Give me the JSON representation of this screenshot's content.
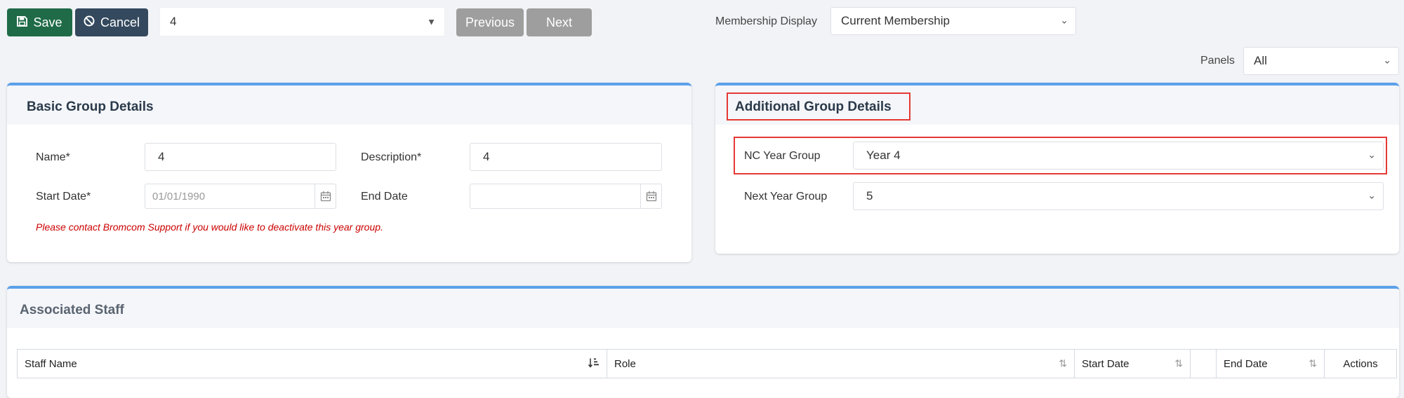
{
  "toolbar": {
    "save_label": "Save",
    "cancel_label": "Cancel",
    "group_select_value": "4",
    "previous_label": "Previous",
    "next_label": "Next",
    "membership_display_label": "Membership Display",
    "membership_display_value": "Current Membership",
    "panels_label": "Panels",
    "panels_value": "All"
  },
  "basic": {
    "title": "Basic Group Details",
    "name_label": "Name*",
    "name_value": "4",
    "description_label": "Description*",
    "description_value": "4",
    "start_date_label": "Start Date*",
    "start_date_placeholder": "01/01/1990",
    "end_date_label": "End Date",
    "end_date_value": "",
    "warning": "Please contact Bromcom Support if you would like to deactivate this year group."
  },
  "additional": {
    "title": "Additional Group Details",
    "nc_year_label": "NC Year Group",
    "nc_year_value": "Year 4",
    "next_year_label": "Next Year Group",
    "next_year_value": "5"
  },
  "staff": {
    "title": "Associated Staff",
    "columns": [
      "Staff Name",
      "Role",
      "Start Date",
      "",
      "End Date",
      "Actions"
    ]
  },
  "colors": {
    "save": "#1f6b47",
    "cancel": "#34495e",
    "panel_accent": "#5aa0ea",
    "highlight": "#e53935",
    "warning": "#cc0000"
  },
  "icons": {
    "save": "save-icon",
    "cancel": "ban-icon",
    "calendar": "calendar-icon",
    "sort": "sort-icon"
  }
}
